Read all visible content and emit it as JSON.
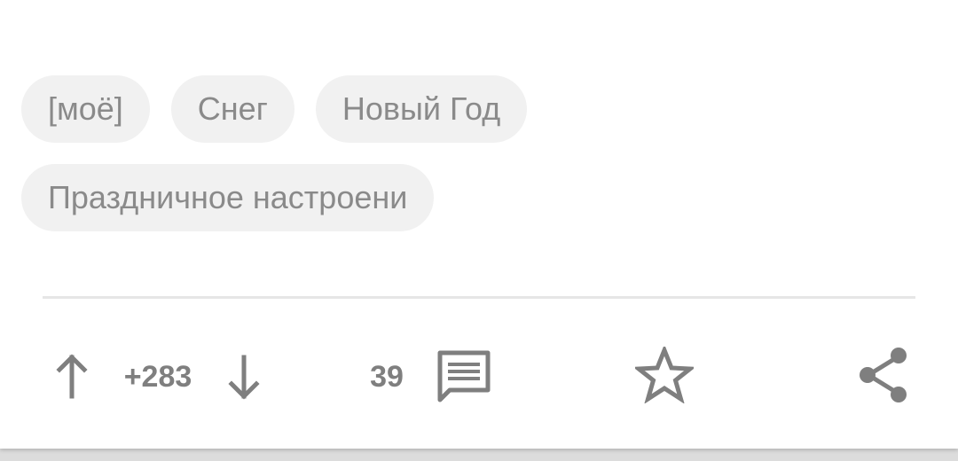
{
  "tags": [
    {
      "label": "[моё]"
    },
    {
      "label": "Снег"
    },
    {
      "label": "Новый Год"
    },
    {
      "label": "Праздничное настроени"
    }
  ],
  "actions": {
    "rating": "+283",
    "comments_count": "39",
    "upvote_icon": "arrow-up-icon",
    "downvote_icon": "arrow-down-icon",
    "comment_icon": "comment-icon",
    "save_icon": "star-icon",
    "share_icon": "share-icon"
  },
  "colors": {
    "icon": "#7f7f7f",
    "tag_background": "#f1f1f1",
    "tag_text": "#8a8a8a",
    "divider": "#e6e6e6"
  }
}
